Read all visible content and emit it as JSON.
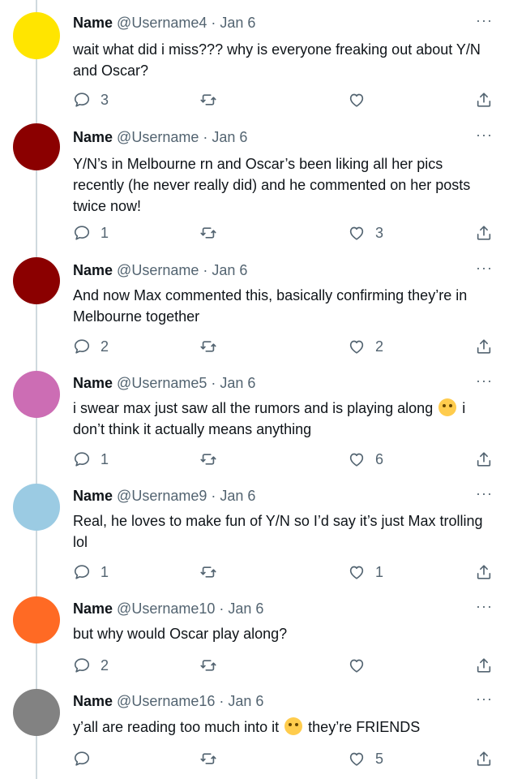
{
  "tweets": [
    {
      "name": "Name",
      "handle": "@Username4",
      "date": "Jan 6",
      "avatar_color": "#ffe500",
      "text": "wait what did i miss??? why is everyone freaking out about Y/N and Oscar?",
      "replies": "3",
      "retweets": "",
      "likes": ""
    },
    {
      "name": "Name",
      "handle": "@Username",
      "date": "Jan 6",
      "avatar_color": "#8b0000",
      "text": "Y/N’s in Melbourne rn and Oscar’s been liking all her pics recently (he never really did) and he commented on her posts twice now!",
      "replies": "1",
      "retweets": "",
      "likes": "3"
    },
    {
      "name": "Name",
      "handle": "@Username",
      "date": "Jan 6",
      "avatar_color": "#8b0000",
      "text": "And now Max commented this, basically confirming they’re in Melbourne together",
      "replies": "2",
      "retweets": "",
      "likes": "2"
    },
    {
      "name": "Name",
      "handle": "@Username5",
      "date": "Jan 6",
      "avatar_color": "#cc6db4",
      "text_before": "i swear max just saw all the rumors and is playing along",
      "text_after": "i don’t think it actually means anything",
      "emoji": "crying-face-emoji",
      "replies": "1",
      "retweets": "",
      "likes": "6"
    },
    {
      "name": "Name",
      "handle": "@Username9",
      "date": "Jan 6",
      "avatar_color": "#9bcbe3",
      "text": "Real, he loves to make fun of Y/N so I’d say it’s just Max trolling lol",
      "replies": "1",
      "retweets": "",
      "likes": "1"
    },
    {
      "name": "Name",
      "handle": "@Username10",
      "date": "Jan 6",
      "avatar_color": "#ff6a24",
      "text": "but why would Oscar play along?",
      "replies": "2",
      "retweets": "",
      "likes": ""
    },
    {
      "name": "Name",
      "handle": "@Username16",
      "date": "Jan 6",
      "avatar_color": "#828282",
      "text_before": "y’all are reading too much into it",
      "text_after": "they’re FRIENDS",
      "emoji": "laughing-tears-emoji",
      "replies": "",
      "retweets": "",
      "likes": "5"
    }
  ],
  "separator": "·",
  "more_label": "···",
  "icons": {
    "reply": "reply-icon",
    "retweet": "retweet-icon",
    "like": "heart-icon",
    "share": "share-icon"
  }
}
